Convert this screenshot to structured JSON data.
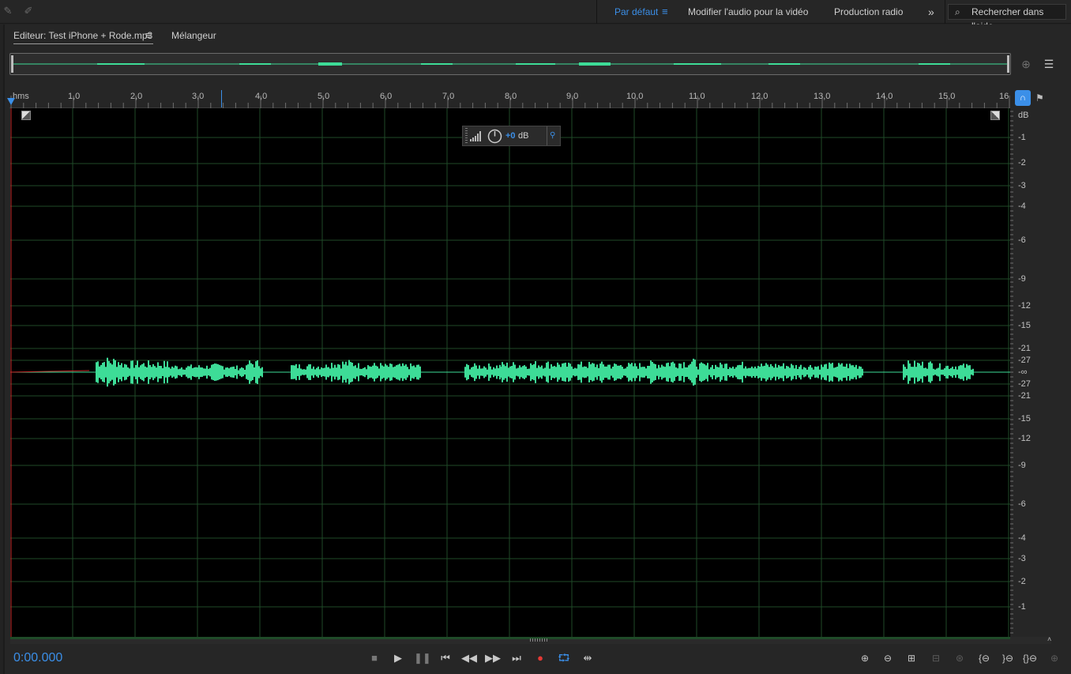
{
  "workspace": {
    "items": [
      {
        "label": "Par défaut",
        "active": true
      },
      {
        "label": "Modifier l'audio pour la vidéo",
        "active": false
      },
      {
        "label": "Production radio",
        "active": false
      }
    ],
    "more": "»",
    "menu_icon": "hamburger-icon"
  },
  "search": {
    "placeholder": "Rechercher dans l'aide",
    "icon": "search-icon"
  },
  "tabs": {
    "editor": "Editeur: Test iPhone + Rode.mp3",
    "mixer": "Mélangeur"
  },
  "ruler": {
    "unit": "hms",
    "labels": [
      "1,0",
      "2,0",
      "3,0",
      "4,0",
      "5,0",
      "6,0",
      "7,0",
      "8,0",
      "9,0",
      "10,0",
      "11,0",
      "12,0",
      "13,0",
      "14,0",
      "15,0",
      "16"
    ]
  },
  "db_scale": {
    "unit": "dB",
    "labels": [
      "-1",
      "-2",
      "-3",
      "-4",
      "-6",
      "-9",
      "-12",
      "-15",
      "-21",
      "-27",
      "-∞",
      "-27",
      "-21",
      "-15",
      "-12",
      "-9",
      "-6",
      "-4",
      "-3",
      "-2",
      "-1"
    ]
  },
  "hud": {
    "value": "+0",
    "unit": "dB"
  },
  "transport": {
    "time": "0:00.000"
  },
  "colors": {
    "accent": "#3b8fe8",
    "waveform": "#3ddc97",
    "grid": "#1f4a28",
    "record": "#e53935"
  }
}
